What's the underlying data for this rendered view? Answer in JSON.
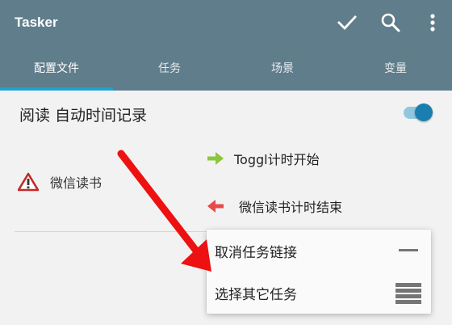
{
  "app": {
    "title": "Tasker"
  },
  "tabs": [
    {
      "label": "配置文件",
      "active": true
    },
    {
      "label": "任务",
      "active": false
    },
    {
      "label": "场景",
      "active": false
    },
    {
      "label": "变量",
      "active": false
    }
  ],
  "profile": {
    "name": "阅读 自动时间记录",
    "enabled": true
  },
  "context": {
    "label": "微信读书",
    "icon": "warning-icon"
  },
  "tasks": {
    "enter": {
      "label": "Toggl计时开始",
      "icon": "arrow-right-icon"
    },
    "exit": {
      "label": "微信读书计时结束",
      "icon": "arrow-left-icon"
    }
  },
  "menu": {
    "items": [
      {
        "label": "取消任务链接",
        "icon": "minus-icon"
      },
      {
        "label": "选择其它任务",
        "icon": "list-icon"
      }
    ]
  },
  "colors": {
    "appbar": "#607d8b",
    "tab_indicator": "#1ba3d6",
    "enter_arrow": "#8cc63f",
    "exit_arrow": "#e84a4a",
    "annotation_arrow": "#ee1111"
  }
}
